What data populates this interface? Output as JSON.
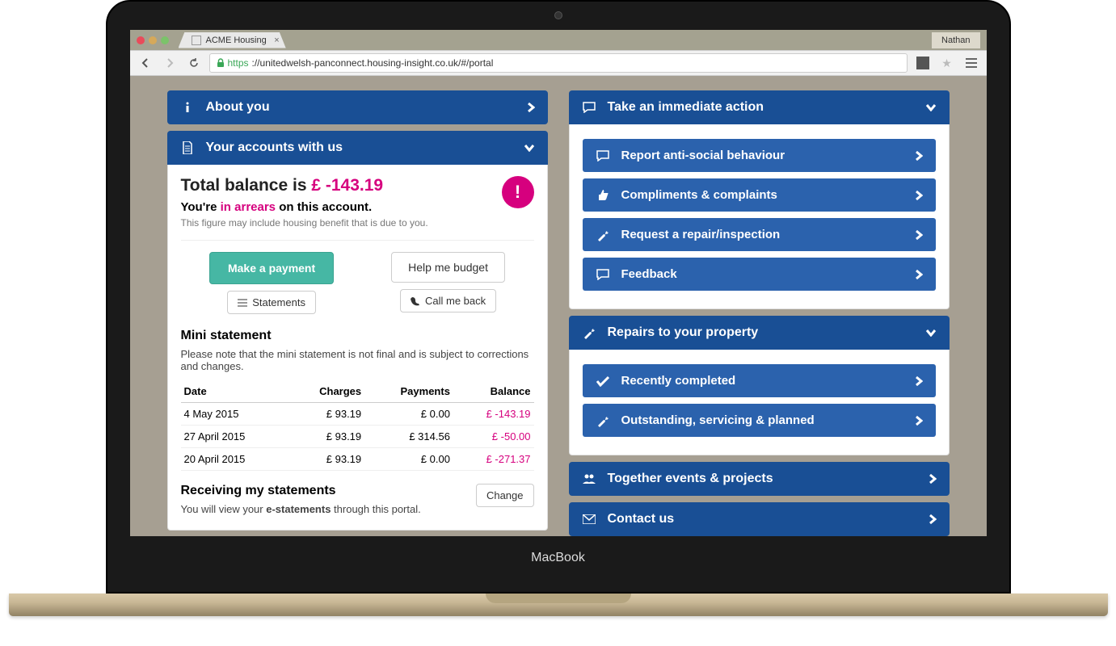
{
  "browser": {
    "tab_title": "ACME Housing",
    "user": "Nathan",
    "url_prefix": "https",
    "url_rest": "://unitedwelsh-panconnect.housing-insight.co.uk/#/portal"
  },
  "left": {
    "about_you": {
      "title": "About you"
    },
    "accounts": {
      "title": "Your accounts with us",
      "total_balance_label": "Total balance is ",
      "total_balance_amount": "£ -143.19",
      "arrears_pre": "You're ",
      "arrears_em": "in arrears",
      "arrears_post": " on this account.",
      "fineprint": "This figure may include housing benefit that is due to you.",
      "buttons": {
        "make_payment": "Make a payment",
        "help_budget": "Help me budget",
        "statements": "Statements",
        "call_me": "Call me back"
      },
      "mini": {
        "title": "Mini statement",
        "note": "Please note that the mini statement is not final and is subject to corrections and changes.",
        "headers": {
          "date": "Date",
          "charges": "Charges",
          "payments": "Payments",
          "balance": "Balance"
        },
        "rows": [
          {
            "date": "4 May 2015",
            "charges": "£ 93.19",
            "payments": "£ 0.00",
            "balance": "£ -143.19"
          },
          {
            "date": "27 April 2015",
            "charges": "£ 93.19",
            "payments": "£ 314.56",
            "balance": "£ -50.00"
          },
          {
            "date": "20 April 2015",
            "charges": "£ 93.19",
            "payments": "£ 0.00",
            "balance": "£ -271.37"
          }
        ]
      },
      "receiving": {
        "title": "Receiving my statements",
        "text_pre": "You will view your ",
        "text_bold": "e-statements",
        "text_post": " through this portal.",
        "change": "Change"
      }
    }
  },
  "right": {
    "immediate": {
      "title": "Take an immediate action",
      "items": [
        {
          "label": "Report anti-social behaviour",
          "icon": "chat"
        },
        {
          "label": "Compliments & complaints",
          "icon": "thumbs"
        },
        {
          "label": "Request a repair/inspection",
          "icon": "wrench"
        },
        {
          "label": "Feedback",
          "icon": "chat"
        }
      ]
    },
    "repairs": {
      "title": "Repairs to your property",
      "items": [
        {
          "label": "Recently completed",
          "icon": "check"
        },
        {
          "label": "Outstanding, servicing & planned",
          "icon": "wrench"
        }
      ]
    },
    "together": {
      "title": "Together events & projects"
    },
    "contact": {
      "title": "Contact us"
    }
  },
  "device_label": "MacBook"
}
